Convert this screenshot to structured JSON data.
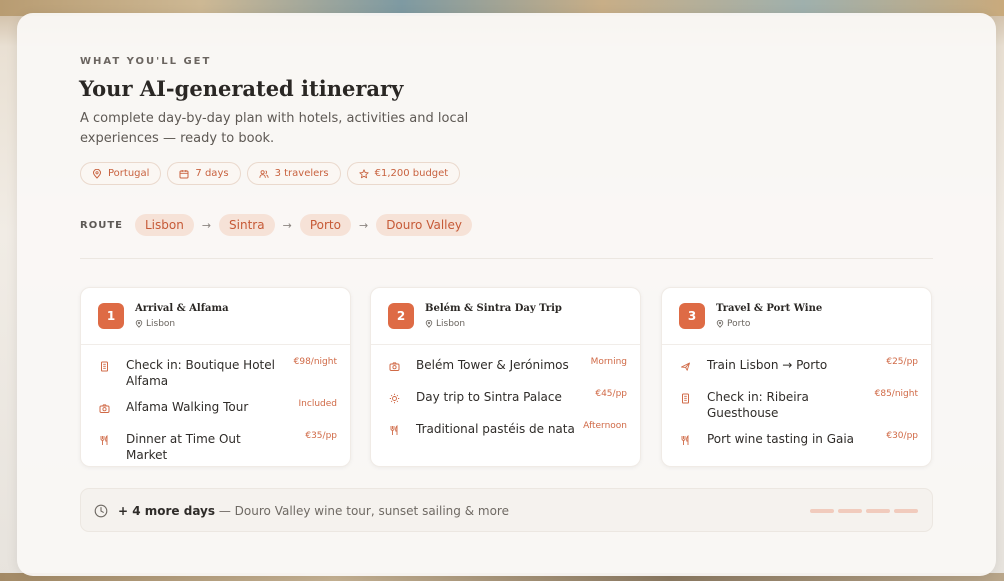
{
  "header": {
    "eyebrow": "WHAT YOU'LL GET",
    "title": "Your AI-generated itinerary",
    "subtitle": "A complete day-by-day plan with hotels, activities and local experiences — ready to book."
  },
  "chips": [
    {
      "icon": "map-pin-icon",
      "label": "Portugal"
    },
    {
      "icon": "calendar-icon",
      "label": "7 days"
    },
    {
      "icon": "users-icon",
      "label": "3 travelers"
    },
    {
      "icon": "star-icon",
      "label": "€1,200 budget"
    }
  ],
  "route": {
    "label": "ROUTE",
    "stops": [
      "Lisbon",
      "Sintra",
      "Porto",
      "Douro Valley"
    ],
    "arrow": "→"
  },
  "days": [
    {
      "number": "1",
      "title": "Arrival & Alfama",
      "location": "Lisbon",
      "items": [
        {
          "icon": "hotel-icon",
          "text": "Check in: Boutique Hotel Alfama",
          "price": "€98/night"
        },
        {
          "icon": "camera-icon",
          "text": "Alfama Walking Tour",
          "price": "Included"
        },
        {
          "icon": "utensils-icon",
          "text": "Dinner at Time Out Market",
          "price": "€35/pp"
        }
      ]
    },
    {
      "number": "2",
      "title": "Belém & Sintra Day Trip",
      "location": "Lisbon",
      "items": [
        {
          "icon": "camera-icon",
          "text": "Belém Tower & Jerónimos",
          "price": "Morning"
        },
        {
          "icon": "sun-icon",
          "text": "Day trip to Sintra Palace",
          "price": "€45/pp"
        },
        {
          "icon": "utensils-icon",
          "text": "Traditional pastéis de nata",
          "price": "Afternoon"
        }
      ]
    },
    {
      "number": "3",
      "title": "Travel & Port Wine",
      "location": "Porto",
      "items": [
        {
          "icon": "plane-icon",
          "text": "Train Lisbon → Porto",
          "price": "€25/pp"
        },
        {
          "icon": "hotel-icon",
          "text": "Check in: Ribeira Guesthouse",
          "price": "€85/night"
        },
        {
          "icon": "utensils-icon",
          "text": "Port wine tasting in Gaia",
          "price": "€30/pp"
        }
      ]
    }
  ],
  "more": {
    "count_label": "+ 4 more days",
    "description": "— Douro Valley wine tour, sunset sailing & more"
  },
  "colors": {
    "accent": "#de6b45",
    "accent_soft": "#f6e2d7",
    "text_dark": "#2a2724"
  }
}
